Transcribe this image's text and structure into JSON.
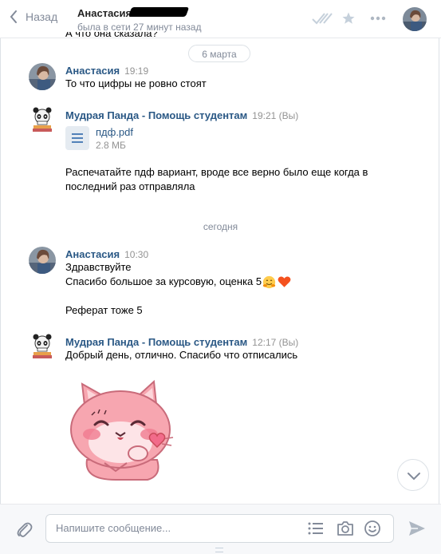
{
  "header": {
    "back_label": "Назад",
    "peer_name": "Анастасия",
    "peer_status": "была в сети 27 минут назад"
  },
  "messages": {
    "cut_text": "А что она сказала?",
    "date_1": "6 марта",
    "msg1": {
      "author": "Анастасия",
      "time": "19:19",
      "text": "То что цифры не ровно стоят"
    },
    "msg2": {
      "author": "Мудрая Панда - Помощь студентам",
      "time": "19:21 (Вы)",
      "doc_name": "пдф.pdf",
      "doc_size": "2.8 МБ",
      "text_line1": "Распечатайте пдф вариант, вроде все верно было еще когда в",
      "text_line2": "последний раз отправляла"
    },
    "date_2": "сегодня",
    "msg3": {
      "author": "Анастасия",
      "time": "10:30",
      "line1": "Здравствуйте",
      "line2": "Спасибо большое за курсовую, оценка 5",
      "line3": "Реферат тоже 5"
    },
    "msg4": {
      "author": "Мудрая Панда - Помощь студентам",
      "time": "12:17 (Вы)",
      "text": "Добрый день, отлично. Спасибо что отписались"
    }
  },
  "composer": {
    "placeholder": "Напишите сообщение..."
  },
  "colors": {
    "link": "#2a5885",
    "muted": "#828a99",
    "accent": "#5181b8"
  }
}
